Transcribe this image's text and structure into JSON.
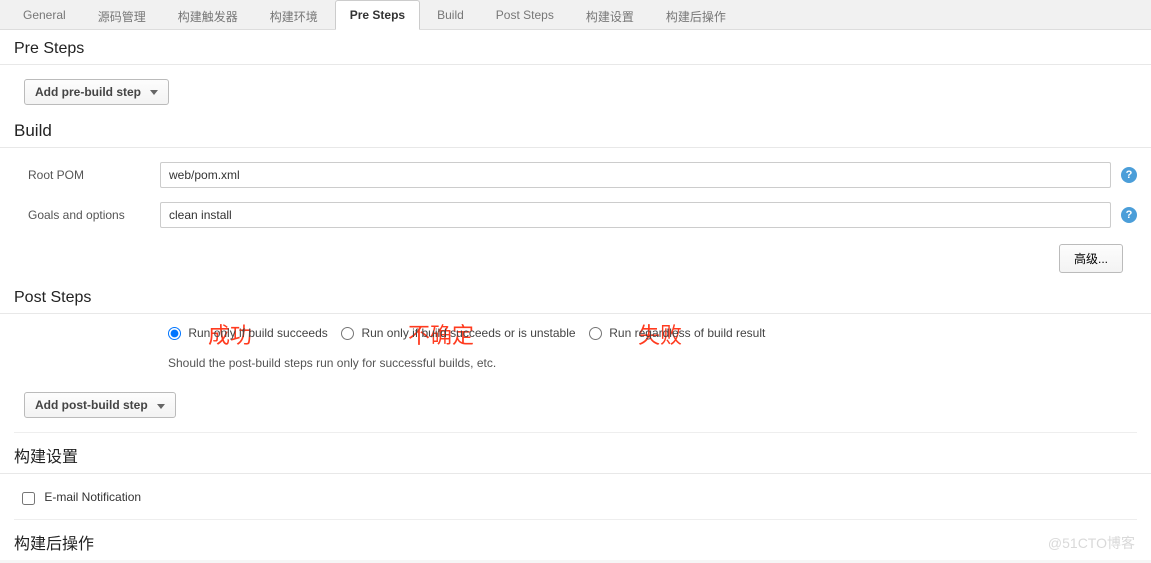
{
  "tabs": {
    "general": "General",
    "scm": "源码管理",
    "triggers": "构建触发器",
    "env": "构建环境",
    "presteps": "Pre Steps",
    "build": "Build",
    "poststeps": "Post Steps",
    "settings": "构建设置",
    "postactions": "构建后操作"
  },
  "sections": {
    "presteps": "Pre Steps",
    "build": "Build",
    "poststeps": "Post Steps",
    "build_settings": "构建设置",
    "post_actions": "构建后操作"
  },
  "buttons": {
    "add_pre": "Add pre-build step",
    "add_post": "Add post-build step",
    "advanced": "高级..."
  },
  "buildform": {
    "root_pom_label": "Root POM",
    "root_pom_value": "web/pom.xml",
    "goals_label": "Goals and options",
    "goals_value": "clean install"
  },
  "poststeps_radio": {
    "succeeds": "Run only if build succeeds",
    "unstable": "Run only if build succeeds or is unstable",
    "regardless": "Run regardless of build result",
    "description": "Should the post-build steps run only for successful builds, etc."
  },
  "annotations": {
    "success": "成功",
    "unsure": "不确定",
    "fail": "失败"
  },
  "build_settings": {
    "email_label": "E-mail Notification"
  },
  "icons": {
    "help": "?"
  },
  "watermark": "@51CTO博客"
}
